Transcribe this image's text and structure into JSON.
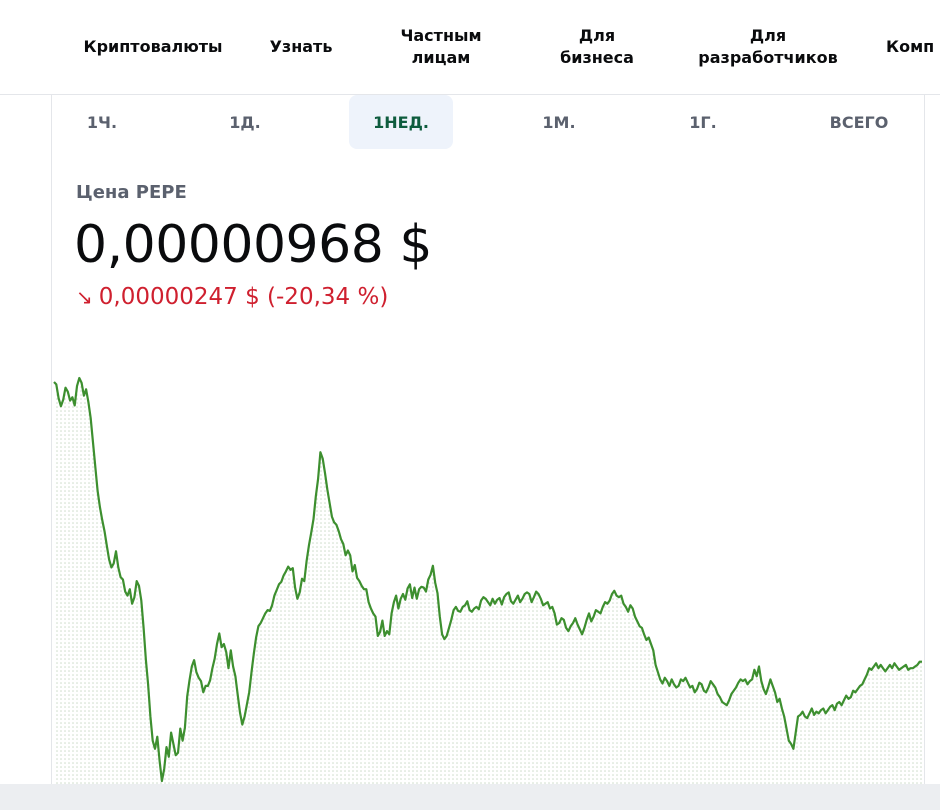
{
  "nav": {
    "items": [
      {
        "label": "Криптовалюты"
      },
      {
        "label": "Узнать"
      },
      {
        "label": "Частным\nлицам"
      },
      {
        "label": "Для\nбизнеса"
      },
      {
        "label": "Для\nразработчиков"
      },
      {
        "label": "Комп"
      }
    ]
  },
  "tabs": [
    {
      "label": "1Ч."
    },
    {
      "label": "1Д."
    },
    {
      "label": "1НЕД."
    },
    {
      "label": "1М."
    },
    {
      "label": "1Г."
    },
    {
      "label": "ВСЕГО"
    }
  ],
  "active_tab": "1НЕД.",
  "price": {
    "label": "Цена PEPE",
    "value": "0,00000968 $",
    "change_text": "0,00000247 $ (-20,34 %)",
    "change_direction_icon": "arrow-down-right-icon"
  },
  "colors": {
    "accent_green": "#0e5c3e",
    "line_green": "#3d8f2f",
    "negative_red": "#cf202f",
    "active_tab_bg": "#eef3fb"
  },
  "chart_data": {
    "type": "area",
    "title": "",
    "xlabel": "",
    "ylabel": "",
    "grid": false,
    "legend": "none",
    "series": [
      {
        "values": [
          12.15,
          12.12,
          11.95,
          11.85,
          11.93,
          12.08,
          12.03,
          11.92,
          11.96,
          11.86,
          12.1,
          12.2,
          12.14,
          11.98,
          12.06,
          11.9,
          11.7,
          11.4,
          11.1,
          10.8,
          10.6,
          10.44,
          10.3,
          10.12,
          9.95,
          9.85,
          9.9,
          10.05,
          9.85,
          9.73,
          9.7,
          9.55,
          9.5,
          9.58,
          9.4,
          9.48,
          9.68,
          9.62,
          9.44,
          9.1,
          8.7,
          8.4,
          8.0,
          7.7,
          7.6,
          7.75,
          7.45,
          7.2,
          7.35,
          7.62,
          7.5,
          7.8,
          7.66,
          7.52,
          7.55,
          7.85,
          7.7,
          7.86,
          8.25,
          8.45,
          8.62,
          8.7,
          8.55,
          8.48,
          8.44,
          8.3,
          8.38,
          8.38,
          8.45,
          8.6,
          8.72,
          8.9,
          9.03,
          8.86,
          8.9,
          8.8,
          8.6,
          8.82,
          8.62,
          8.5,
          8.27,
          8.05,
          7.9,
          8.0,
          8.15,
          8.3,
          8.55,
          8.78,
          8.98,
          9.12,
          9.16,
          9.22,
          9.28,
          9.32,
          9.31,
          9.38,
          9.5,
          9.57,
          9.64,
          9.67,
          9.75,
          9.8,
          9.86,
          9.82,
          9.84,
          9.6,
          9.46,
          9.54,
          9.71,
          9.68,
          9.93,
          10.12,
          10.28,
          10.45,
          10.73,
          10.95,
          11.28,
          11.2,
          11.02,
          10.82,
          10.65,
          10.48,
          10.41,
          10.38,
          10.3,
          10.2,
          10.14,
          10.0,
          10.06,
          10.0,
          9.8,
          9.88,
          9.72,
          9.68,
          9.62,
          9.58,
          9.58,
          9.42,
          9.34,
          9.28,
          9.24,
          9.0,
          9.05,
          9.19,
          9.0,
          9.06,
          9.02,
          9.28,
          9.42,
          9.5,
          9.34,
          9.46,
          9.52,
          9.45,
          9.59,
          9.64,
          9.47,
          9.6,
          9.46,
          9.58,
          9.61,
          9.6,
          9.55,
          9.7,
          9.76,
          9.87,
          9.66,
          9.53,
          9.24,
          9.02,
          8.96,
          9.0,
          9.1,
          9.2,
          9.32,
          9.36,
          9.31,
          9.3,
          9.36,
          9.38,
          9.43,
          9.32,
          9.3,
          9.34,
          9.36,
          9.33,
          9.44,
          9.48,
          9.46,
          9.42,
          9.38,
          9.46,
          9.4,
          9.45,
          9.47,
          9.39,
          9.48,
          9.52,
          9.54,
          9.43,
          9.4,
          9.45,
          9.5,
          9.42,
          9.46,
          9.52,
          9.54,
          9.52,
          9.42,
          9.48,
          9.55,
          9.52,
          9.46,
          9.38,
          9.4,
          9.42,
          9.34,
          9.36,
          9.28,
          9.14,
          9.16,
          9.22,
          9.2,
          9.1,
          9.06,
          9.12,
          9.16,
          9.22,
          9.14,
          9.08,
          9.02,
          9.1,
          9.2,
          9.28,
          9.18,
          9.24,
          9.32,
          9.3,
          9.28,
          9.36,
          9.42,
          9.4,
          9.44,
          9.52,
          9.56,
          9.5,
          9.48,
          9.5,
          9.4,
          9.36,
          9.3,
          9.38,
          9.34,
          9.24,
          9.18,
          9.12,
          9.1,
          9.02,
          8.95,
          8.98,
          8.9,
          8.82,
          8.64,
          8.55,
          8.46,
          8.41,
          8.48,
          8.44,
          8.38,
          8.46,
          8.4,
          8.36,
          8.38,
          8.46,
          8.44,
          8.48,
          8.42,
          8.36,
          8.38,
          8.3,
          8.34,
          8.42,
          8.4,
          8.32,
          8.3,
          8.36,
          8.44,
          8.4,
          8.36,
          8.28,
          8.24,
          8.18,
          8.16,
          8.14,
          8.2,
          8.28,
          8.32,
          8.36,
          8.42,
          8.46,
          8.44,
          8.46,
          8.4,
          8.44,
          8.46,
          8.58,
          8.5,
          8.62,
          8.44,
          8.34,
          8.28,
          8.36,
          8.46,
          8.38,
          8.3,
          8.18,
          8.22,
          8.1,
          8.0,
          7.85,
          7.7,
          7.66,
          7.6,
          7.8,
          8.0,
          8.02,
          8.06,
          8.0,
          7.98,
          8.04,
          8.1,
          8.02,
          8.06,
          8.04,
          8.08,
          8.1,
          8.04,
          8.08,
          8.12,
          8.14,
          8.08,
          8.16,
          8.18,
          8.14,
          8.2,
          8.26,
          8.22,
          8.24,
          8.32,
          8.3,
          8.34,
          8.38,
          8.4,
          8.46,
          8.52,
          8.6,
          8.58,
          8.62,
          8.66,
          8.6,
          8.64,
          8.6,
          8.56,
          8.6,
          8.64,
          8.6,
          8.66,
          8.62,
          8.58,
          8.6,
          8.62,
          8.64,
          8.58,
          8.6,
          8.6,
          8.62,
          8.64,
          8.68,
          8.68
        ]
      }
    ]
  }
}
